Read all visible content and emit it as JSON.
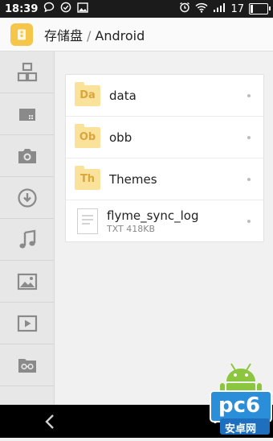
{
  "status_bar": {
    "time": "18:39",
    "battery_level": "17",
    "battery_fraction": 0.17,
    "icons": [
      "chat-bubble-icon",
      "check-circle-icon",
      "image-icon",
      "alarm-clock-icon",
      "wifi-icon",
      "signal-icon",
      "battery-icon"
    ]
  },
  "header": {
    "root": "存储盘",
    "separator": "/",
    "current": "Android",
    "app_icon": "storage-folder-icon"
  },
  "sidebar": {
    "items": [
      {
        "name": "category-icon"
      },
      {
        "name": "sd-card-icon"
      },
      {
        "name": "camera-icon"
      },
      {
        "name": "download-icon"
      },
      {
        "name": "music-icon"
      },
      {
        "name": "gallery-icon"
      },
      {
        "name": "video-icon"
      },
      {
        "name": "glasses-folder-icon"
      }
    ]
  },
  "files": [
    {
      "name": "data",
      "badge": "Da",
      "type": "folder"
    },
    {
      "name": "obb",
      "badge": "Ob",
      "type": "folder"
    },
    {
      "name": "Themes",
      "badge": "Th",
      "type": "folder"
    },
    {
      "name": "flyme_sync_log",
      "meta": "TXT 418KB",
      "type": "file"
    }
  ],
  "watermark": {
    "text_logo": "pc6",
    "text_sub": "安卓网"
  },
  "colors": {
    "folder": "#fbe29a",
    "folder_text": "#d9a53c",
    "app_icon": "#f6c64a",
    "status_bar": "#1b1b1b",
    "nav_bar": "#000000"
  }
}
